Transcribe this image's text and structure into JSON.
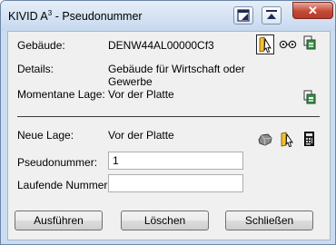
{
  "window": {
    "title_prefix": "KIVID A",
    "title_sup": "3",
    "title_suffix": " - Pseudonummer",
    "close_glyph": "✕"
  },
  "info": {
    "gebaeude_label": "Gebäude:",
    "gebaeude_value": "DENW44AL00000Cf3",
    "details_label": "Details:",
    "details_line1": "Gebäude für Wirtschaft oder",
    "details_line2": "Gewerbe",
    "lage_label": "Momentane Lage:",
    "lage_value": "Vor der Platte"
  },
  "form": {
    "neue_lage_label": "Neue Lage:",
    "neue_lage_value": "Vor der Platte",
    "pseudonummer_label": "Pseudonummer:",
    "pseudonummer_value": "1",
    "laufende_label": "Laufende Nummer:",
    "laufende_value": ""
  },
  "buttons": {
    "execute": "Ausführen",
    "delete": "Löschen",
    "close": "Schließen"
  },
  "icons": [
    "window-mode-icon",
    "collapse-icon",
    "pick-building-icon",
    "view-icon",
    "database-icon",
    "shape-icon",
    "calculator-icon"
  ]
}
